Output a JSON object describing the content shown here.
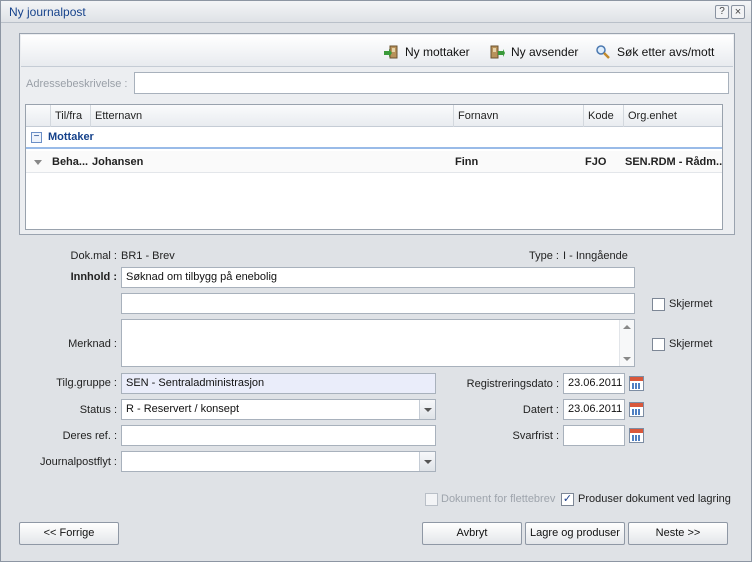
{
  "window": {
    "title": "Ny journalpost",
    "help_label": "?",
    "close_label": "×"
  },
  "toolbar": {
    "new_recipient": "Ny mottaker",
    "new_sender": "Ny avsender",
    "search": "Søk etter avs/mott"
  },
  "address": {
    "label": "Adressebeskrivelse :",
    "value": ""
  },
  "grid": {
    "headers": [
      "Til/fra",
      "Etternavn",
      "Fornavn",
      "Kode",
      "Org.enhet"
    ],
    "group": {
      "toggle": "−",
      "label": "Mottaker"
    },
    "rows": [
      {
        "tilfra": "Beha...",
        "etternavn": "Johansen",
        "fornavn": "Finn",
        "kode": "FJO",
        "org": "SEN.RDM - Rådm..."
      }
    ]
  },
  "form": {
    "dokmal_label": "Dok.mal :",
    "dokmal_value": "BR1 - Brev",
    "type_label": "Type :",
    "type_value": "I - Inngående",
    "innhold_label": "Innhold :",
    "innhold_value": "Søknad om tilbygg på enebolig",
    "innhold2_value": "",
    "skjermet_label": "Skjermet",
    "merknad_label": "Merknad :",
    "merknad_value": "",
    "tilg_label": "Tilg.gruppe :",
    "tilg_value": "SEN - Sentraladministrasjon",
    "status_label": "Status :",
    "status_value": "R - Reservert / konsept",
    "deres_label": "Deres ref. :",
    "deres_value": "",
    "flyt_label": "Journalpostflyt :",
    "flyt_value": "",
    "regdato_label": "Registreringsdato :",
    "regdato_value": "23.06.2011",
    "datert_label": "Datert :",
    "datert_value": "23.06.2011",
    "svarfrist_label": "Svarfrist :",
    "svarfrist_value": ""
  },
  "options": {
    "flettebrev_label": "Dokument for flettebrev",
    "flettebrev_checked": false,
    "flettebrev_enabled": false,
    "produser_label": "Produser dokument ved lagring",
    "produser_checked": true
  },
  "buttons": {
    "prev": "<< Forrige",
    "cancel": "Avbryt",
    "save_produce": "Lagre og produser",
    "next": "Neste >>"
  },
  "colors": {
    "title": "#15428b",
    "group": "#15428b",
    "tint_field": "#eaedfa"
  }
}
